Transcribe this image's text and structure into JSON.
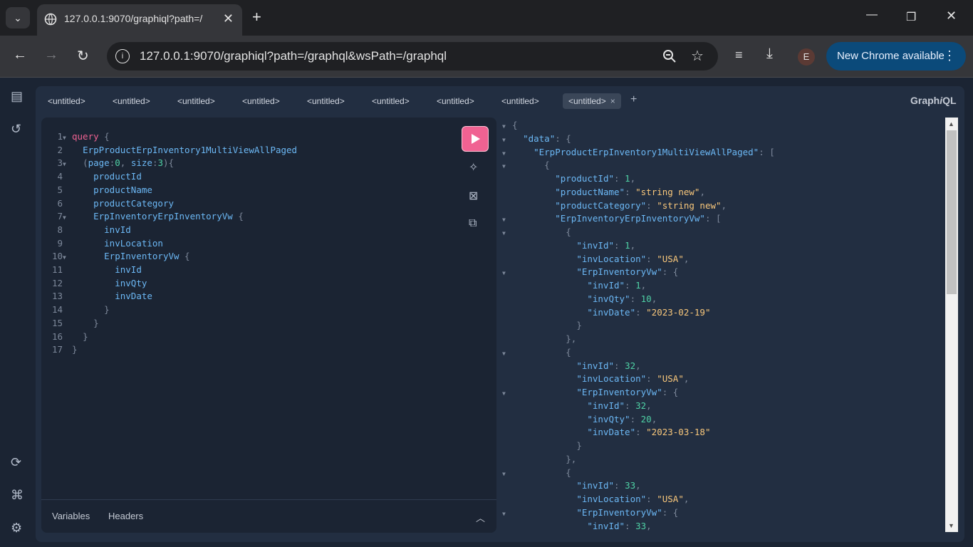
{
  "browser": {
    "tab_title": "127.0.0.1:9070/graphiql?path=/",
    "url_host": "127.0.0.1",
    "url_rest": ":9070/graphiql?path=/graphql&wsPath=/graphql",
    "avatar_letter": "E",
    "update_label": "New Chrome available",
    "icons": [
      "tab-search-icon",
      "globe-icon",
      "close-icon",
      "plus-icon",
      "minimize-icon",
      "restore-icon",
      "window-close-icon",
      "back-icon",
      "forward-icon",
      "reload-icon",
      "info-icon",
      "zoom-icon",
      "star-icon",
      "media-icon",
      "download-icon",
      "menu-dots-icon"
    ]
  },
  "graphiql": {
    "logo_prefix": "Graph",
    "logo_i": "i",
    "logo_suffix": "QL",
    "tabs": [
      "<untitled>",
      "<untitled>",
      "<untitled>",
      "<untitled>",
      "<untitled>",
      "<untitled>",
      "<untitled>",
      "<untitled>"
    ],
    "active_tab_index": 7,
    "tab_close": "×",
    "add_tab": "+",
    "variables_label": "Variables",
    "headers_label": "Headers"
  },
  "query": {
    "l1_kw": "query",
    "l1_brace": "{",
    "l2_field": "ErpProductErpInventory1MultiViewAllPaged",
    "l3_open": "(",
    "l3_arg1": "page",
    "l3_colon1": ":",
    "l3_val1": "0",
    "l3_comma": ", ",
    "l3_arg2": "size",
    "l3_colon2": ":",
    "l3_val2": "3",
    "l3_close": "){",
    "l4": "productId",
    "l5": "productName",
    "l6": "productCategory",
    "l7": "ErpInventoryErpInventoryVw",
    "l7_brace": "{",
    "l8": "invId",
    "l9": "invLocation",
    "l10": "ErpInventoryVw",
    "l10_brace": "{",
    "l11": "invId",
    "l12": "invQty",
    "l13": "invDate",
    "close": "}"
  },
  "result": {
    "open": "{",
    "k_data": "\"data\"",
    "k_root": "\"ErpProductErpInventory1MultiViewAllPaged\"",
    "k_productId": "\"productId\"",
    "k_productName": "\"productName\"",
    "k_productCategory": "\"productCategory\"",
    "k_inv": "\"ErpInventoryErpInventoryVw\"",
    "k_invId": "\"invId\"",
    "k_invLocation": "\"invLocation\"",
    "k_vw": "\"ErpInventoryVw\"",
    "k_invQty": "\"invQty\"",
    "k_invDate": "\"invDate\"",
    "productId": "1",
    "productName": "\"string new\"",
    "productCategory": "\"string new\"",
    "inv1_id": "1",
    "inv1_loc": "\"USA\"",
    "inv1_vw_id": "1",
    "inv1_qty": "10",
    "inv1_date": "\"2023-02-19\"",
    "inv2_id": "32",
    "inv2_loc": "\"USA\"",
    "inv2_vw_id": "32",
    "inv2_qty": "20",
    "inv2_date": "\"2023-03-18\"",
    "inv3_id": "33",
    "inv3_loc": "\"USA\"",
    "inv3_vw_id": "33"
  }
}
